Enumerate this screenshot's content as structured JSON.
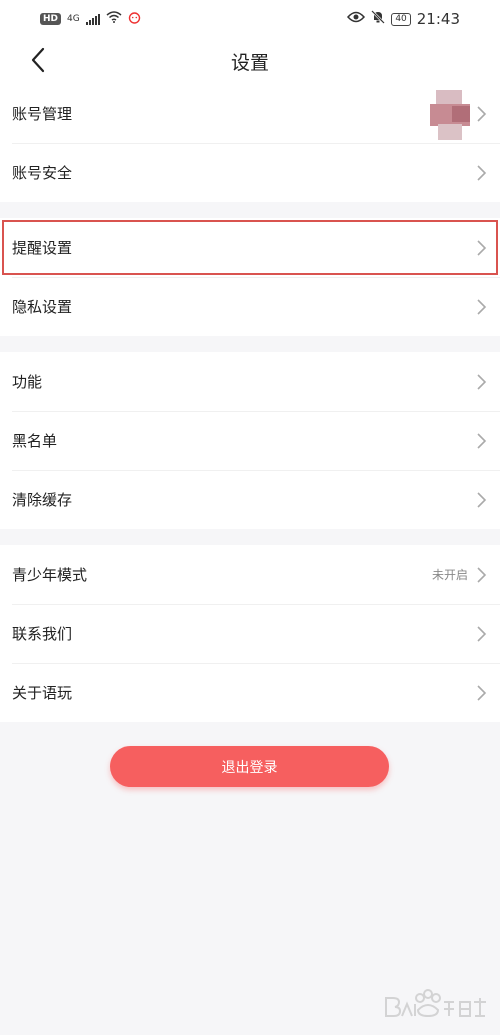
{
  "status_bar": {
    "network_badge": "HD",
    "signal_type": "4G",
    "battery_level": "40",
    "time": "21:43"
  },
  "nav": {
    "title": "设置"
  },
  "groups": [
    {
      "items": [
        {
          "label": "账号管理"
        },
        {
          "label": "账号安全"
        }
      ]
    },
    {
      "items": [
        {
          "label": "提醒设置"
        },
        {
          "label": "隐私设置"
        }
      ]
    },
    {
      "items": [
        {
          "label": "功能"
        },
        {
          "label": "黑名单"
        },
        {
          "label": "清除缓存"
        }
      ]
    },
    {
      "items": [
        {
          "label": "青少年模式",
          "value": "未开启"
        },
        {
          "label": "联系我们"
        },
        {
          "label": "关于语玩"
        }
      ]
    }
  ],
  "logout": {
    "label": "退出登录"
  },
  "colors": {
    "accent": "#f65f5f",
    "highlight_box": "#d9534f",
    "page_background": "#f6f6f8"
  },
  "icons": [
    "back-arrow-icon",
    "chevron-right-icon",
    "eye-icon",
    "wifi-icon",
    "bell-off-icon",
    "battery-icon"
  ]
}
